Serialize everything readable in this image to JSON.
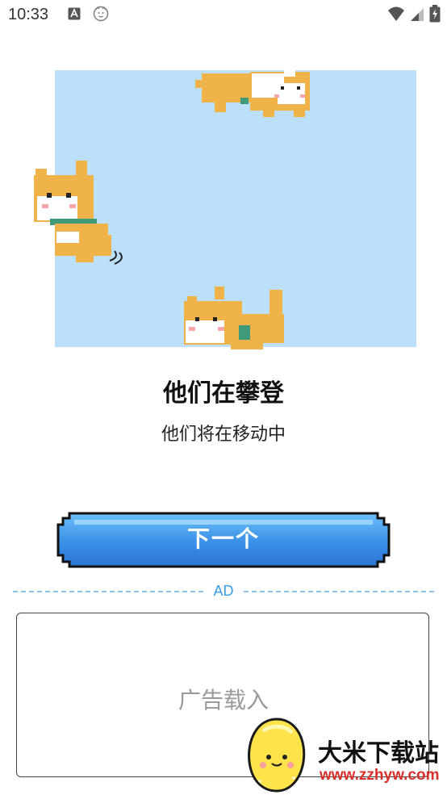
{
  "status_bar": {
    "time": "10:33"
  },
  "content": {
    "title": "他们在攀登",
    "subtitle": "他们将在移动中"
  },
  "buttons": {
    "next_label": "下一个"
  },
  "ad": {
    "divider_label": "AD",
    "loading_text": "广告载入"
  },
  "watermark": {
    "site_name": "大米下载站",
    "site_url": "www.zzhyw.com"
  },
  "colors": {
    "illustration_bg": "#bde0fa",
    "button_blue": "#3a8fe8",
    "ad_accent": "#3a9ee6",
    "watermark_url": "#d9302c"
  }
}
